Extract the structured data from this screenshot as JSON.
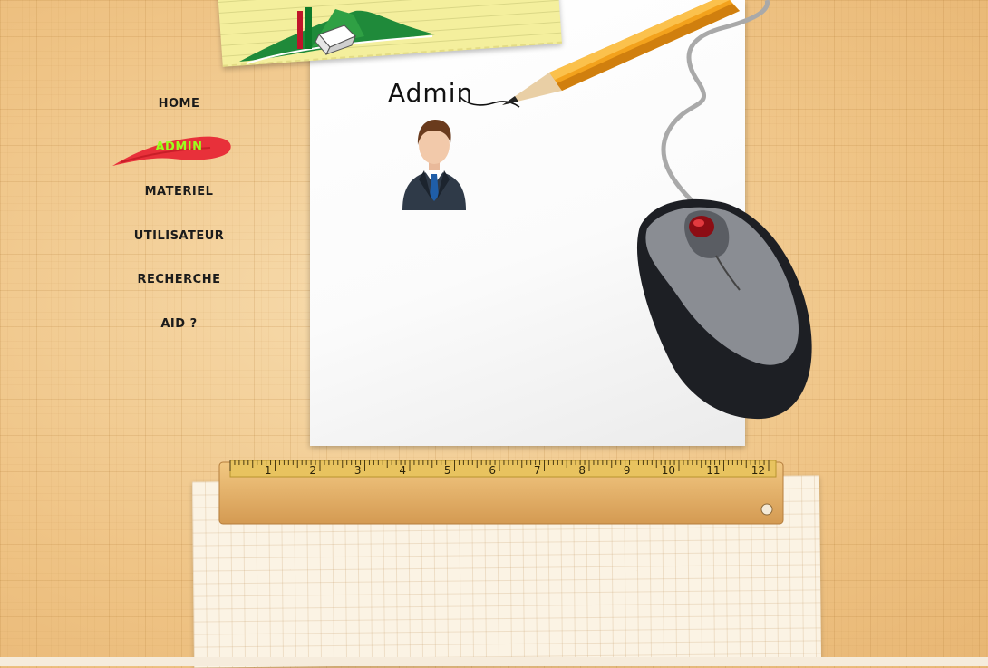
{
  "page": {
    "title": "Admin"
  },
  "nav": {
    "items": [
      {
        "label": "HOME",
        "active": false
      },
      {
        "label": "ADMIN",
        "active": true
      },
      {
        "label": "MATERIEL",
        "active": false
      },
      {
        "label": "UTILISATEUR",
        "active": false
      },
      {
        "label": "RECHERCHE",
        "active": false
      },
      {
        "label": "AID ?",
        "active": false
      }
    ]
  },
  "ruler": {
    "marks": [
      "1",
      "2",
      "3",
      "4",
      "5",
      "6",
      "7",
      "8",
      "9",
      "10",
      "11",
      "12"
    ]
  },
  "colors": {
    "active_nav": "#9bff1e",
    "brush": "#e8303a",
    "pencil": "#f3a21c",
    "sticky_note": "#f4ef9d"
  },
  "icons": {
    "logo": "logo-icon",
    "avatar": "user-avatar-icon",
    "pencil": "pencil-icon",
    "mouse": "computer-mouse-icon",
    "ruler": "ruler-icon"
  }
}
